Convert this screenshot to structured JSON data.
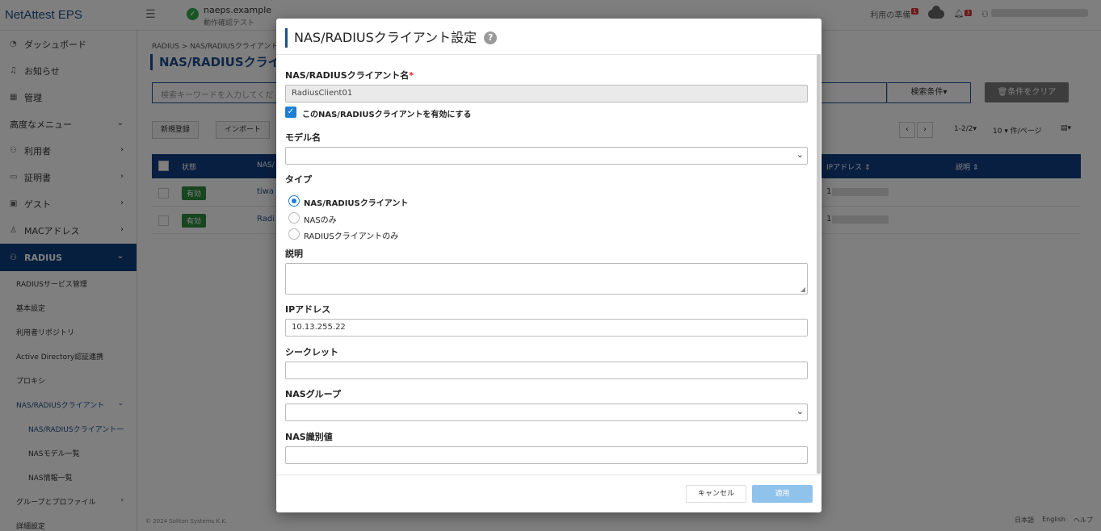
{
  "header": {
    "logo": "NetAttest EPS",
    "tenant_name": "naeps.example",
    "tenant_sub": "動作確認テスト",
    "prep_label": "利用の準備",
    "prep_badge": "1",
    "bell_badge": "3"
  },
  "sidebar": {
    "items": [
      {
        "label": "ダッシュボード",
        "icon": "gauge-icon"
      },
      {
        "label": "お知らせ",
        "icon": "bell-icon"
      },
      {
        "label": "管理",
        "icon": "grid-icon"
      },
      {
        "label": "高度なメニュー",
        "icon": ""
      },
      {
        "label": "利用者",
        "icon": "users-icon"
      },
      {
        "label": "証明書",
        "icon": "certificate-icon"
      },
      {
        "label": "ゲスト",
        "icon": "guest-icon"
      },
      {
        "label": "MACアドレス",
        "icon": "device-icon"
      },
      {
        "label": "RADIUS",
        "icon": "radius-icon"
      }
    ],
    "sub_items": [
      "RADIUSサービス管理",
      "基本設定",
      "利用者リポジトリ",
      "Active Directory認証連携",
      "プロキシ",
      "NAS/RADIUSクライアント"
    ],
    "subsub_items": [
      "NAS/RADIUSクライアント一",
      "NASモデル一覧",
      "NAS情報一覧"
    ],
    "after_items": [
      "グループとプロファイル",
      "詳細設定"
    ]
  },
  "main": {
    "breadcrumb": "RADIUS > NAS/RADIUSクライアント",
    "title": "NAS/RADIUSクライア",
    "search_placeholder": "検索キーワードを入力してくだ",
    "search_cond": "検索条件▾",
    "clear_label": "条件をクリア",
    "new_label": "新規登録",
    "import_label": "インポート",
    "page_info": "1-2/2▾",
    "per_page": "10 ▾ 件/ページ",
    "columns": {
      "status": "状態",
      "name": "NAS/",
      "ip": "IPアドレス ⇕",
      "desc": "説明 ⇕"
    },
    "rows": [
      {
        "status": "有効",
        "name": "tiwa",
        "ip": "1"
      },
      {
        "status": "有効",
        "name": "Radi",
        "ip": "1"
      }
    ],
    "copyright": "© 2024 Soliton Systems K.K.",
    "lang_ja": "日本語",
    "lang_en": "English",
    "help": "ヘルプ"
  },
  "modal": {
    "title": "NAS/RADIUSクライアント設定",
    "fields": {
      "client_name_label": "NAS/RADIUSクライアント名",
      "client_name_required": "*",
      "client_name_value": "RadiusClient01",
      "enable_label": "このNAS/RADIUSクライアントを有効にする",
      "model_label": "モデル名",
      "type_label": "タイプ",
      "type_options": [
        "NAS/RADIUSクライアント",
        "NASのみ",
        "RADIUSクライアントのみ"
      ],
      "type_selected": 0,
      "desc_label": "説明",
      "ip_label": "IPアドレス",
      "ip_value": "10.13.255.22",
      "secret_label": "シークレット",
      "nas_group_label": "NASグループ",
      "nas_id_label": "NAS識別値"
    },
    "cancel_label": "キャンセル",
    "apply_label": "適用"
  }
}
